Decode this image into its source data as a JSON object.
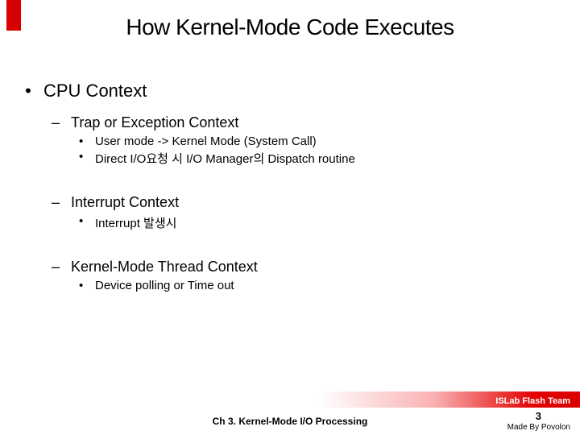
{
  "title": "How Kernel-Mode Code Executes",
  "content": {
    "lvl1": "CPU Context",
    "sections": [
      {
        "heading": "Trap or Exception Context",
        "items": [
          "User mode -> Kernel Mode (System Call)",
          "Direct I/O요청 시 I/O Manager의 Dispatch routine"
        ]
      },
      {
        "heading": "Interrupt Context",
        "items": [
          "Interrupt 발생시"
        ]
      },
      {
        "heading": "Kernel-Mode Thread Context",
        "items": [
          "Device polling or Time out"
        ]
      }
    ]
  },
  "footer": {
    "team": "ISLab Flash Team",
    "chapter": "Ch 3. Kernel-Mode I/O Processing",
    "page": "3",
    "madeby": "Made By Povolon"
  },
  "bullets": {
    "lvl1": "•",
    "lvl2": "–",
    "lvl3": "•"
  }
}
